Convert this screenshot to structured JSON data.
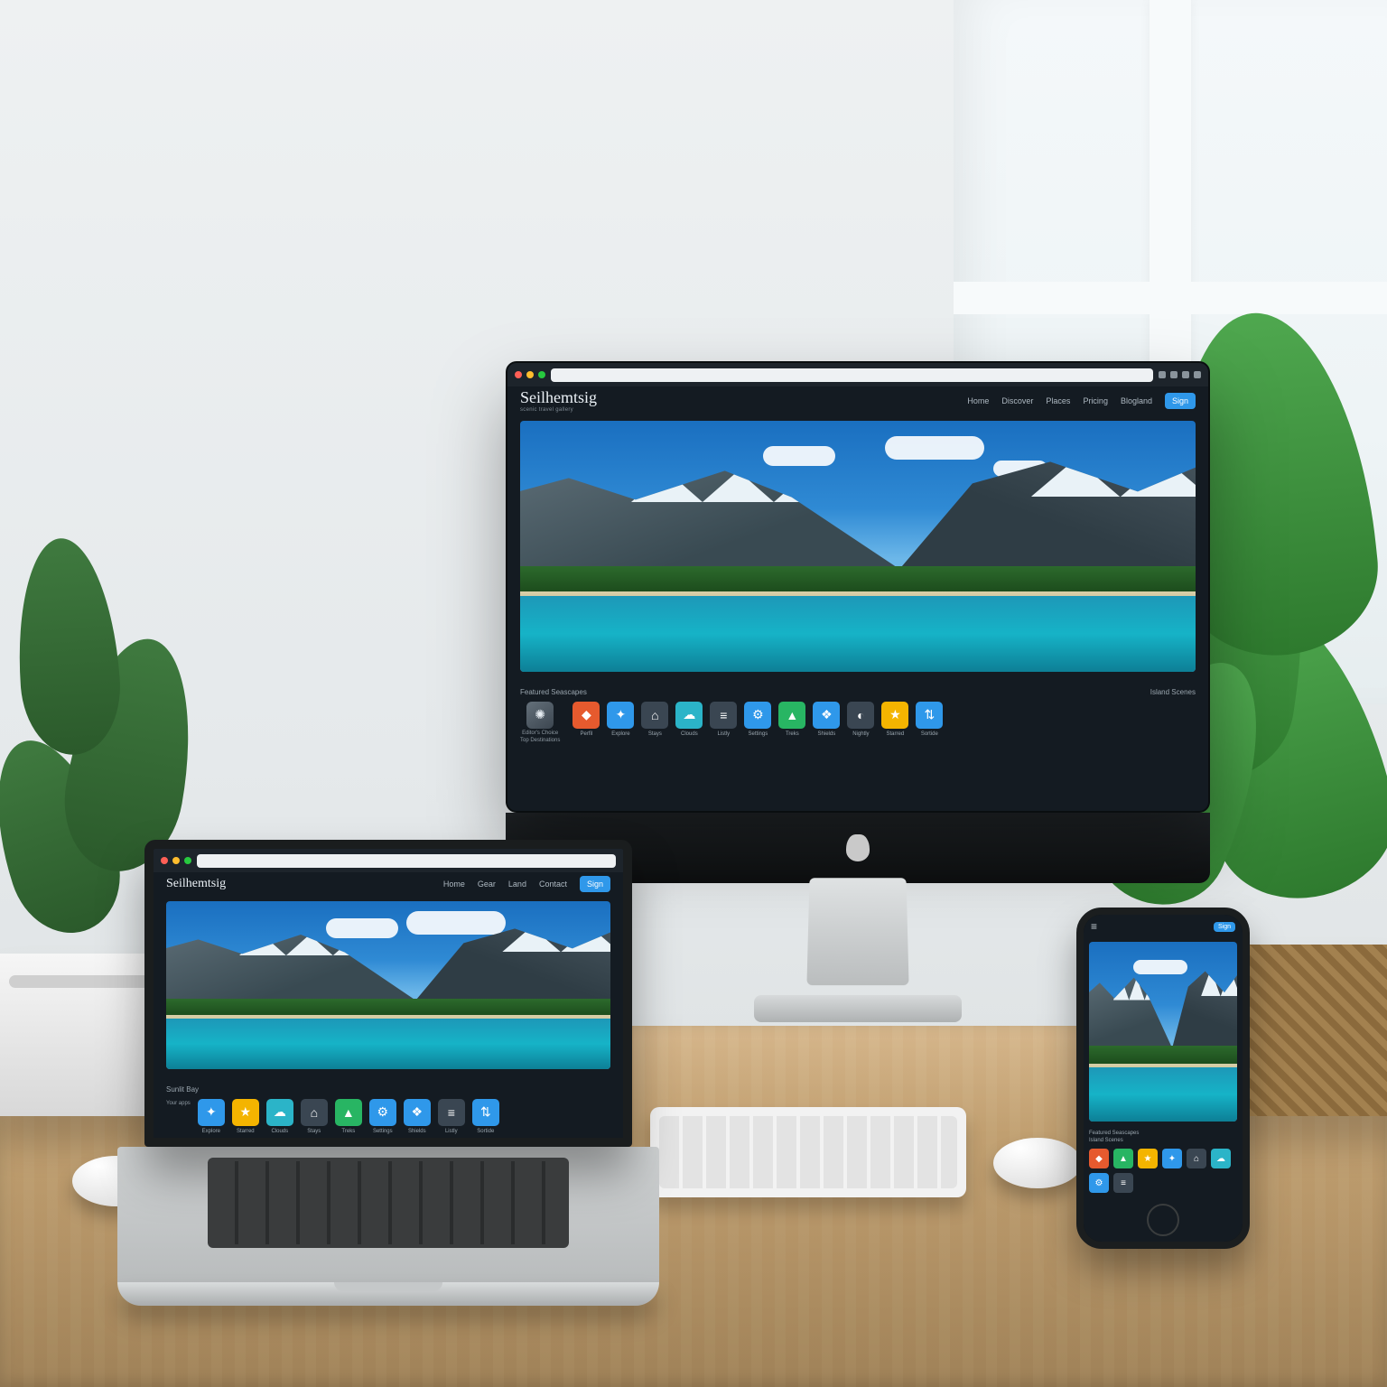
{
  "browser": {
    "dot_colors": [
      "#ff5f56",
      "#ffbd2e",
      "#27c93f"
    ]
  },
  "site": {
    "brand": "Seilhemtsig",
    "brand_sub": "scenic travel gallery",
    "nav": [
      "Home",
      "Discover",
      "Places",
      "Pricing",
      "Blogland"
    ],
    "cta": "Sign",
    "section_left": "Featured Seascapes",
    "section_right": "Island Scenes",
    "badge_label": "Editor's Choice",
    "badge_sub": "Top Destinations",
    "tiles": [
      {
        "color": "#e65a2e",
        "icon": "◆",
        "label": "Perfil"
      },
      {
        "color": "#2f98ea",
        "icon": "✦",
        "label": "Explore"
      },
      {
        "color": "#3a4652",
        "icon": "⌂",
        "label": "Stays"
      },
      {
        "color": "#2bb4c8",
        "icon": "☁",
        "label": "Clouds"
      },
      {
        "color": "#3a4652",
        "icon": "≡",
        "label": "Listly"
      },
      {
        "color": "#2f98ea",
        "icon": "⚙",
        "label": "Settings"
      },
      {
        "color": "#28b563",
        "icon": "▲",
        "label": "Treks"
      },
      {
        "color": "#2f98ea",
        "icon": "❖",
        "label": "Shields"
      },
      {
        "color": "#3a4652",
        "icon": "◐",
        "label": "Nightly"
      },
      {
        "color": "#f4b400",
        "icon": "★",
        "label": "Starred"
      },
      {
        "color": "#2f98ea",
        "icon": "⇅",
        "label": "Sortide"
      }
    ],
    "tiles_laptop": [
      {
        "color": "#2f98ea",
        "icon": "✦",
        "label": "Explore"
      },
      {
        "color": "#f4b400",
        "icon": "★",
        "label": "Starred"
      },
      {
        "color": "#2bb4c8",
        "icon": "☁",
        "label": "Clouds"
      },
      {
        "color": "#3a4652",
        "icon": "⌂",
        "label": "Stays"
      },
      {
        "color": "#28b563",
        "icon": "▲",
        "label": "Treks"
      },
      {
        "color": "#2f98ea",
        "icon": "⚙",
        "label": "Settings"
      },
      {
        "color": "#2f98ea",
        "icon": "❖",
        "label": "Shields"
      },
      {
        "color": "#3a4652",
        "icon": "≡",
        "label": "Listly"
      },
      {
        "color": "#2f98ea",
        "icon": "⇅",
        "label": "Sortide"
      }
    ],
    "tiles_phone": [
      {
        "color": "#e65a2e",
        "icon": "◆"
      },
      {
        "color": "#28b563",
        "icon": "▲"
      },
      {
        "color": "#f4b400",
        "icon": "★"
      },
      {
        "color": "#2f98ea",
        "icon": "✦"
      },
      {
        "color": "#3a4652",
        "icon": "⌂"
      },
      {
        "color": "#2bb4c8",
        "icon": "☁"
      },
      {
        "color": "#2f98ea",
        "icon": "⚙"
      },
      {
        "color": "#3a4652",
        "icon": "≡"
      }
    ],
    "nav_laptop": [
      "Home",
      "Gear",
      "Land",
      "Contact"
    ],
    "section_laptop": "Sunlit Bay",
    "apps_label": "Your apps"
  }
}
